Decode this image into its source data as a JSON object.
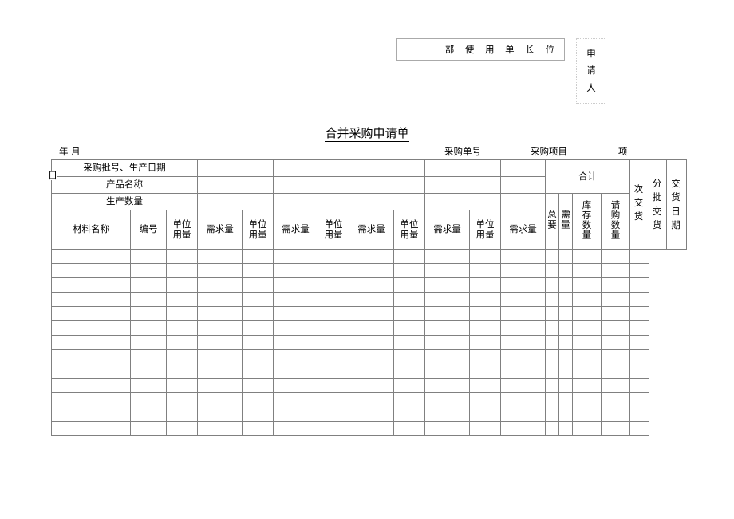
{
  "page": {
    "title": "合并采购申请单"
  },
  "approval": {
    "signature_line": "部 使 用 单 长 位",
    "applicant_label_chars": [
      "申",
      "请",
      "人"
    ]
  },
  "meta": {
    "year_month": "年  月",
    "day": "日",
    "order_no_label": "采购单号",
    "project_label": "采购项目",
    "unit_label": "项"
  },
  "table": {
    "row_labels": {
      "batch_date": "采购批号、生产日期",
      "product_name": "产品名称",
      "production_qty": "生产数量"
    },
    "group_headers": {
      "total": "合计"
    },
    "columns": {
      "material_name": "材料名称",
      "code": "编号",
      "unit_usage_line1": "单位",
      "unit_usage_line2": "用量",
      "demand_qty": "需求量",
      "total_required_a": "总要",
      "total_required_b": "需量",
      "stock_qty": "库存数量",
      "request_qty": "请购数量",
      "batch_delivery_a": "次 交",
      "batch_delivery_b": "货",
      "split_delivery": "分 批交 货",
      "delivery_date": "交 货日 期"
    },
    "usage_group_count": 5,
    "body_row_count": 13,
    "body_cells": [
      "",
      "",
      "",
      "",
      "",
      "",
      "",
      "",
      "",
      "",
      "",
      "",
      "",
      "",
      "",
      "",
      ""
    ]
  },
  "colors": {
    "grid_line": "#808080",
    "box_border": "#aaaaaa",
    "dotted_border": "#cccccc",
    "text": "#000000"
  }
}
